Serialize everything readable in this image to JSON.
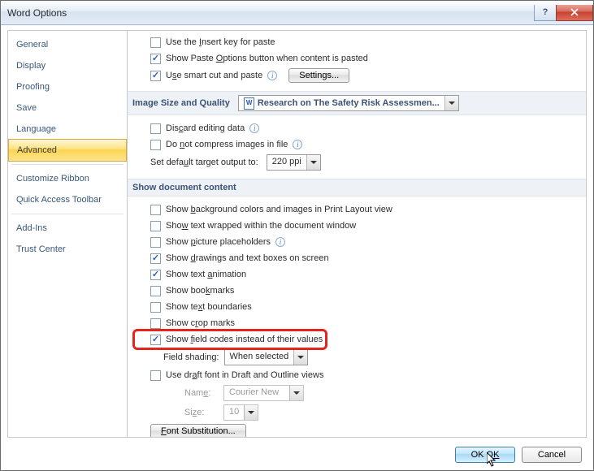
{
  "window": {
    "title": "Word Options"
  },
  "sidebar": {
    "items": [
      {
        "label": "General"
      },
      {
        "label": "Display"
      },
      {
        "label": "Proofing"
      },
      {
        "label": "Save"
      },
      {
        "label": "Language"
      },
      {
        "label": "Advanced",
        "selected": true
      },
      {
        "sep": true
      },
      {
        "label": "Customize Ribbon"
      },
      {
        "label": "Quick Access Toolbar"
      },
      {
        "sep": true
      },
      {
        "label": "Add-Ins"
      },
      {
        "label": "Trust Center"
      }
    ]
  },
  "paste": {
    "insert_key": {
      "text": "Use the Insert key for paste",
      "checked": false,
      "u": "I"
    },
    "show_options": {
      "text": "Show Paste Options button when content is pasted",
      "checked": true,
      "u": "O"
    },
    "smart_cut": {
      "text": "Use smart cut and paste",
      "checked": true,
      "u": "s"
    },
    "settings_btn": "Settings..."
  },
  "image_section": {
    "header": "Image Size and Quality",
    "doc_select": "Research on The Safety Risk Assessmen...",
    "discard": {
      "text": "Discard editing data",
      "checked": false,
      "u": "c"
    },
    "no_compress": {
      "text": "Do not compress images in file",
      "checked": false,
      "u": "n"
    },
    "target_label": "Set default target output to:",
    "target_value": "220 ppi",
    "target_u": "u"
  },
  "doc_section": {
    "header": "Show document content",
    "items": [
      {
        "text": "Show background colors and images in Print Layout view",
        "checked": false,
        "u": "b"
      },
      {
        "text": "Show text wrapped within the document window",
        "checked": false,
        "u": "w"
      },
      {
        "text": "Show picture placeholders",
        "checked": false,
        "u": "p",
        "info": true
      },
      {
        "text": "Show drawings and text boxes on screen",
        "checked": true,
        "u": "d"
      },
      {
        "text": "Show text animation",
        "checked": true,
        "u": "a"
      },
      {
        "text": "Show bookmarks",
        "checked": false,
        "u": "k"
      },
      {
        "text": "Show text boundaries",
        "checked": false,
        "u": "x"
      },
      {
        "text": "Show crop marks",
        "checked": false,
        "u": "r"
      },
      {
        "text": "Show field codes instead of their values",
        "checked": true,
        "u": "f",
        "highlight": true
      }
    ],
    "field_shading_label": "Field shading:",
    "field_shading_value": "When selected",
    "draft_font": {
      "text": "Use draft font in Draft and Outline views",
      "checked": false,
      "u": "a"
    },
    "name_label": "Name:",
    "name_value": "Courier New",
    "name_u": "e",
    "size_label": "Size:",
    "size_value": "10",
    "size_u": "z",
    "font_sub_btn": "Font Substitution...",
    "font_sub_u": "F"
  },
  "footer": {
    "ok": "OK",
    "cancel": "Cancel"
  }
}
